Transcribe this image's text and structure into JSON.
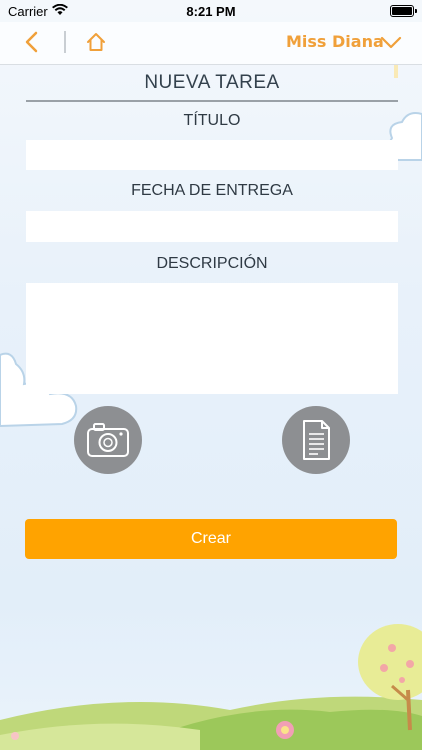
{
  "status_bar": {
    "carrier": "Carrier",
    "time": "8:21 PM",
    "wifi_icon": "wifi-icon",
    "battery_icon": "battery-icon"
  },
  "nav": {
    "back_icon": "chevron-left-icon",
    "home_icon": "home-icon",
    "user_name": "Miss Diana",
    "dropdown_icon": "chevron-down-icon",
    "accent_color": "#f0a03a"
  },
  "form": {
    "heading": "NUEVA TAREA",
    "titulo_label": "TÍTULO",
    "titulo_value": "",
    "fecha_label": "FECHA DE ENTREGA",
    "fecha_value": "",
    "descripcion_label": "DESCRIPCIÓN",
    "descripcion_value": "",
    "camera_icon": "camera-icon",
    "document_icon": "document-icon",
    "submit_label": "Crear",
    "submit_color": "#ffa300"
  }
}
